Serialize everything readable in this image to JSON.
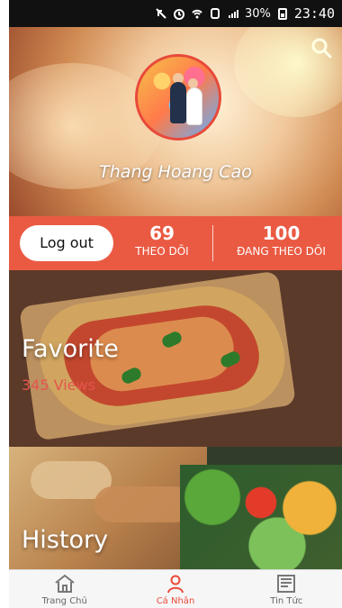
{
  "status_bar": {
    "battery": "30%",
    "time": "23:40"
  },
  "profile": {
    "name": "Thang Hoang Cao"
  },
  "stats": {
    "logout_label": "Log out",
    "followers_count": "69",
    "followers_label": "THEO DÕI",
    "following_count": "100",
    "following_label": "ĐANG THEO DÕI"
  },
  "cards": [
    {
      "title": "Favorite",
      "views": "345 Views"
    },
    {
      "title": "History"
    }
  ],
  "bottom_nav": [
    {
      "label": "Trang Chủ",
      "icon": "home-icon",
      "active": false
    },
    {
      "label": "Cá Nhân",
      "icon": "user-icon",
      "active": true
    },
    {
      "label": "Tin Tức",
      "icon": "news-icon",
      "active": false
    }
  ],
  "colors": {
    "accent": "#E84A3A",
    "stats_bg": "#EA5A43",
    "views": "#E5554D"
  }
}
